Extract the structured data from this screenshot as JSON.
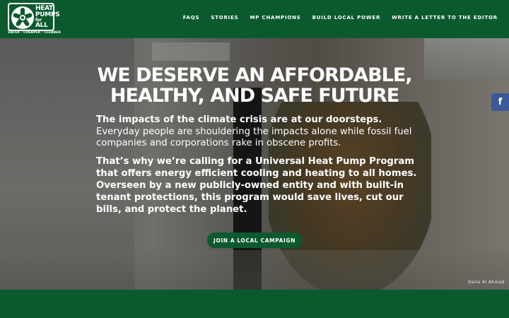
{
  "brand": {
    "logo_lines": [
      "HEAT",
      "PUMPS",
      "for",
      "ALL"
    ],
    "tagline": "SAFER · CHEAPER · CLEANER",
    "colors": {
      "primary": "#0b5a2e",
      "facebook": "#3b5998"
    },
    "logo_icon": "fan-icon"
  },
  "nav": {
    "items": [
      {
        "label": "FAQS"
      },
      {
        "label": "STORIES"
      },
      {
        "label": "MP CHAMPIONS"
      },
      {
        "label": "BUILD LOCAL POWER"
      },
      {
        "label": "WRITE A LETTER TO THE EDITOR"
      }
    ]
  },
  "hero": {
    "headline": "WE DESERVE AN AFFORDABLE, HEALTHY, AND SAFE FUTURE",
    "para1_bold": "The impacts of the climate crisis are at our doorsteps.",
    "para1_rest": " Everyday people are shouldering the impacts alone while fossil fuel companies and corporations rake in obscene profits.",
    "para2": "That’s why we’re calling for a Universal Heat Pump Program that offers energy efficient cooling and heating to all homes. Overseen by a new publicly-owned entity and with built-in tenant protections, this program would save lives, cut our bills, and protect the planet.",
    "cta_label": "JOIN A LOCAL CAMPAIGN",
    "photo_credit": "Dalia Al Ahmad"
  },
  "social": {
    "facebook_glyph": "f",
    "facebook_icon": "facebook-icon"
  }
}
